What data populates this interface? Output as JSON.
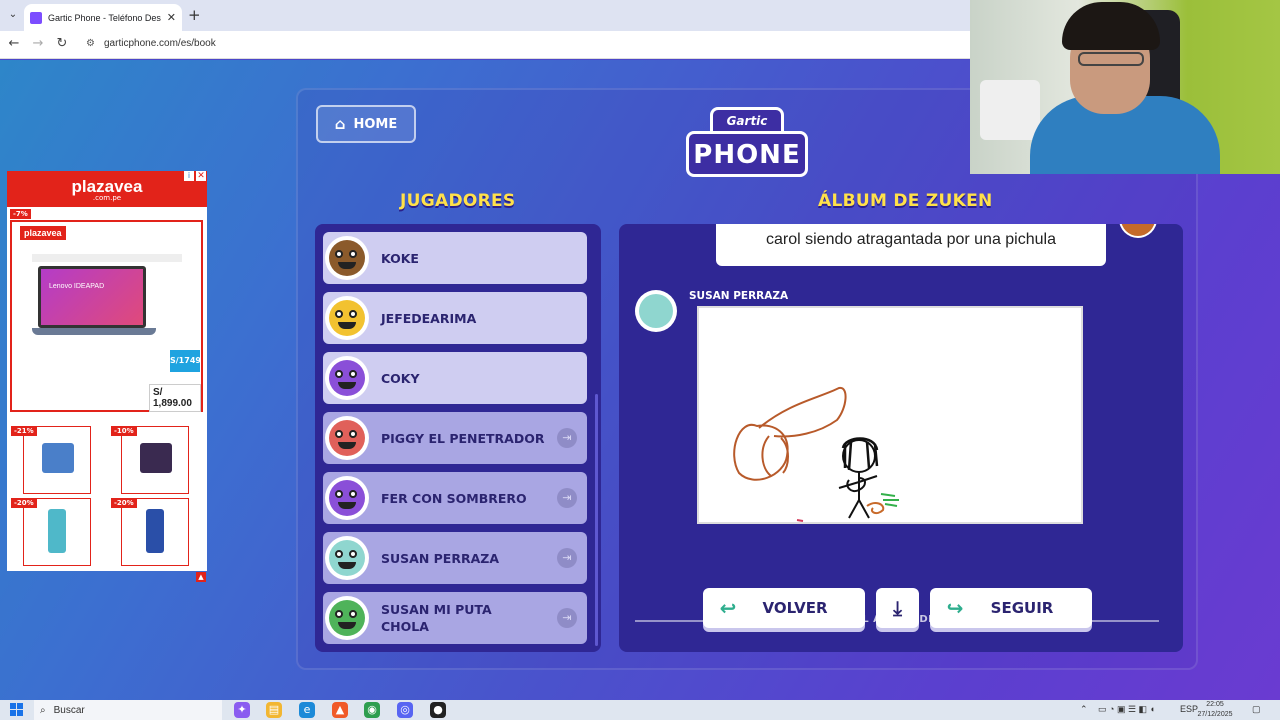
{
  "browser": {
    "tab_title": "Gartic Phone - Teléfono Descon",
    "url": "garticphone.com/es/book"
  },
  "ad": {
    "brand": "plazavea",
    "brand_domain": ".com.pe",
    "mini_brand": "plazavea",
    "main_discount": "-7%",
    "laptop_text": "Lenovo IDEAPAD",
    "oh_price": "S/1749",
    "price": "S/ 1,899.00",
    "products": [
      {
        "discount": "-21%"
      },
      {
        "discount": "-10%"
      },
      {
        "discount": "-20%"
      },
      {
        "discount": "-20%"
      }
    ]
  },
  "game": {
    "home_label": "HOME",
    "logo_small": "Gartic",
    "logo_word": "PHONE",
    "players_title": "JUGADORES",
    "album_title": "ÁLBUM DE ZUKEN",
    "players": [
      {
        "name": "KOKE",
        "color": "#8b5a2b",
        "kick": false
      },
      {
        "name": "JEFEDEARIMA",
        "color": "#f2c230",
        "kick": false
      },
      {
        "name": "COKY",
        "color": "#8a4fd8",
        "kick": false
      },
      {
        "name": "PIGGY EL PENETRADOR",
        "color": "#e0605a",
        "kick": true
      },
      {
        "name": "FER CON SOMBRERO",
        "color": "#8a4fd8",
        "kick": true
      },
      {
        "name": "SUSAN PERRAZA",
        "color": "#8fd6cf",
        "kick": true
      },
      {
        "name": "SUSAN MI PUTA CHOLA",
        "color": "#4fb35a",
        "kick": true
      }
    ],
    "phrase": "carol siendo atragantada por una pichula",
    "author": "SUSAN PERRAZA",
    "end_text": "FIN DEL ÁLBUM DE ZUKEN",
    "back_label": "VOLVER",
    "next_label": "SEGUIR"
  },
  "taskbar": {
    "search_placeholder": "Buscar",
    "language": "ESP",
    "time": "22:05",
    "date": "27/12/2025"
  }
}
